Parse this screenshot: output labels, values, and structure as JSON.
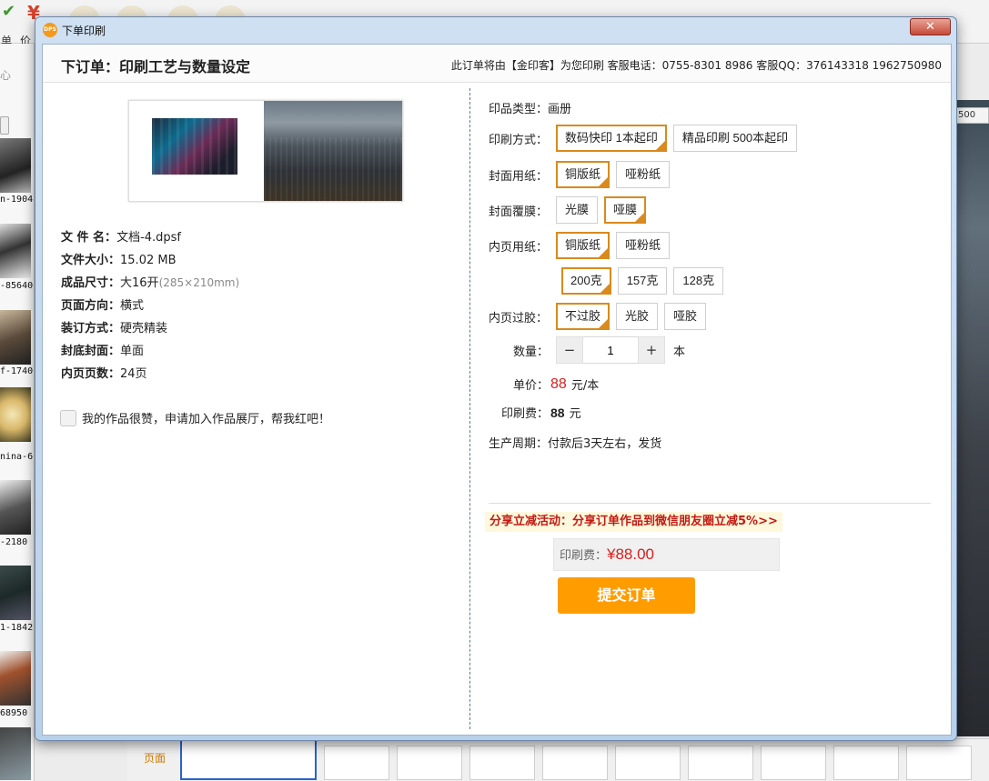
{
  "window": {
    "title": "下单印刷",
    "logo_text": "DPS",
    "close_glyph": "✕"
  },
  "header": {
    "title": "下订单：印刷工艺与数量设定",
    "contact": "此订单将由【金印客】为您印刷 客服电话：0755-8301 8986 客服QQ：376143318 1962750980"
  },
  "file_info": [
    {
      "key": "文  件  名：",
      "value": "文档-4.dpsf",
      "sub": ""
    },
    {
      "key": "文件大小：",
      "value": "15.02 MB",
      "sub": ""
    },
    {
      "key": "成品尺寸：",
      "value": "大16开",
      "sub": "(285×210mm)"
    },
    {
      "key": "页面方向：",
      "value": "横式",
      "sub": ""
    },
    {
      "key": "装订方式：",
      "value": "硬壳精装",
      "sub": ""
    },
    {
      "key": "封底封面：",
      "value": "单面",
      "sub": ""
    },
    {
      "key": "内页页数：",
      "value": "24页",
      "sub": ""
    }
  ],
  "gallery_option": {
    "label": "我的作品很赞，申请加入作品展厅，帮我红吧！",
    "checked": false
  },
  "form": {
    "product_type": {
      "label": "印品类型：",
      "value": "画册"
    },
    "print_method": {
      "label": "印刷方式：",
      "options": [
        "数码快印 1本起印",
        "精品印刷 500本起印"
      ],
      "selected": 0
    },
    "cover_paper": {
      "label": "封面用纸：",
      "options": [
        "铜版纸",
        "哑粉纸"
      ],
      "selected": 0
    },
    "cover_film": {
      "label": "封面覆膜：",
      "options": [
        "光膜",
        "哑膜"
      ],
      "selected": 1
    },
    "inner_paper": {
      "label": "内页用纸：",
      "options": [
        "铜版纸",
        "哑粉纸"
      ],
      "selected": 0
    },
    "inner_weight": {
      "options": [
        "200克",
        "157克",
        "128克"
      ],
      "selected": 0
    },
    "inner_lamination": {
      "label": "内页过胶：",
      "options": [
        "不过胶",
        "光胶",
        "哑胶"
      ],
      "selected": 0
    },
    "quantity": {
      "label": "数量：",
      "value": "1",
      "minus": "−",
      "plus": "+",
      "unit": "本"
    },
    "unit_price": {
      "label": "单价：",
      "value": "88",
      "unit": "元/本"
    },
    "print_fee": {
      "label": "印刷费：",
      "value": "88",
      "unit": "元"
    },
    "production_cycle": {
      "label": "生产周期：",
      "value": "付款后3天左右，发货"
    }
  },
  "promo": {
    "text": "分享立减活动：分享订单作品到微信朋友圈立减5%>>"
  },
  "total": {
    "label": "印刷费：",
    "amount": "¥88.00"
  },
  "submit": {
    "label": "提交订单"
  },
  "background": {
    "toolbar_labels": [
      "单",
      "价"
    ],
    "sidebar_label": "心",
    "thumb_captions": [
      "n-1904",
      "-85640",
      "f-1740",
      "nina-6",
      "-2180",
      "1-1842",
      "68950"
    ],
    "ruler_text": "500",
    "page_tab_label": "页面"
  },
  "colors": {
    "accent": "#ff9d00",
    "selected_border": "#d98a1c",
    "price_red": "#d8201c",
    "promo_bg": "#fff8dc"
  }
}
